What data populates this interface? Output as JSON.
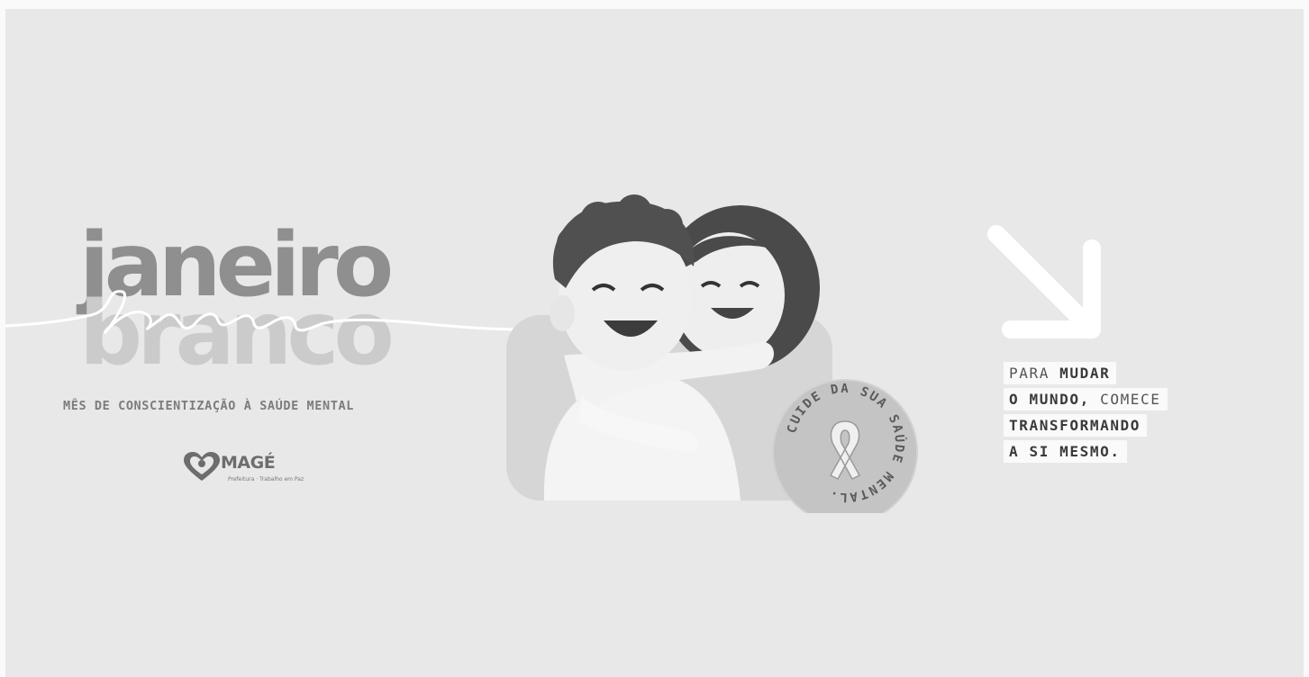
{
  "headline": {
    "word1": "janeiro",
    "word2": "branco",
    "script_word": "branco"
  },
  "subtitle": "MÊS DE CONSCIENTIZAÇÃO À SAÚDE MENTAL",
  "logo": {
    "name": "MAGÉ",
    "tagline": "Prefeitura · Trabalho em Paz"
  },
  "seal_text": "CUIDE DA SUA SAÚDE MENTAL.",
  "quote": {
    "line1_a": "PARA ",
    "line1_b": "MUDAR",
    "line2_a": "O MUNDO,",
    "line2_b": " COMECE",
    "line3": "TRANSFORMANDO",
    "line4": "A SI MESMO."
  },
  "colors": {
    "background": "#e8e8e8",
    "headline_dark": "#8f8f8f",
    "headline_light": "#cbcbcb",
    "quote_box": "#fafafa"
  },
  "icons": [
    "heart-logo-icon",
    "ribbon-icon",
    "arrow-down-right-icon"
  ]
}
